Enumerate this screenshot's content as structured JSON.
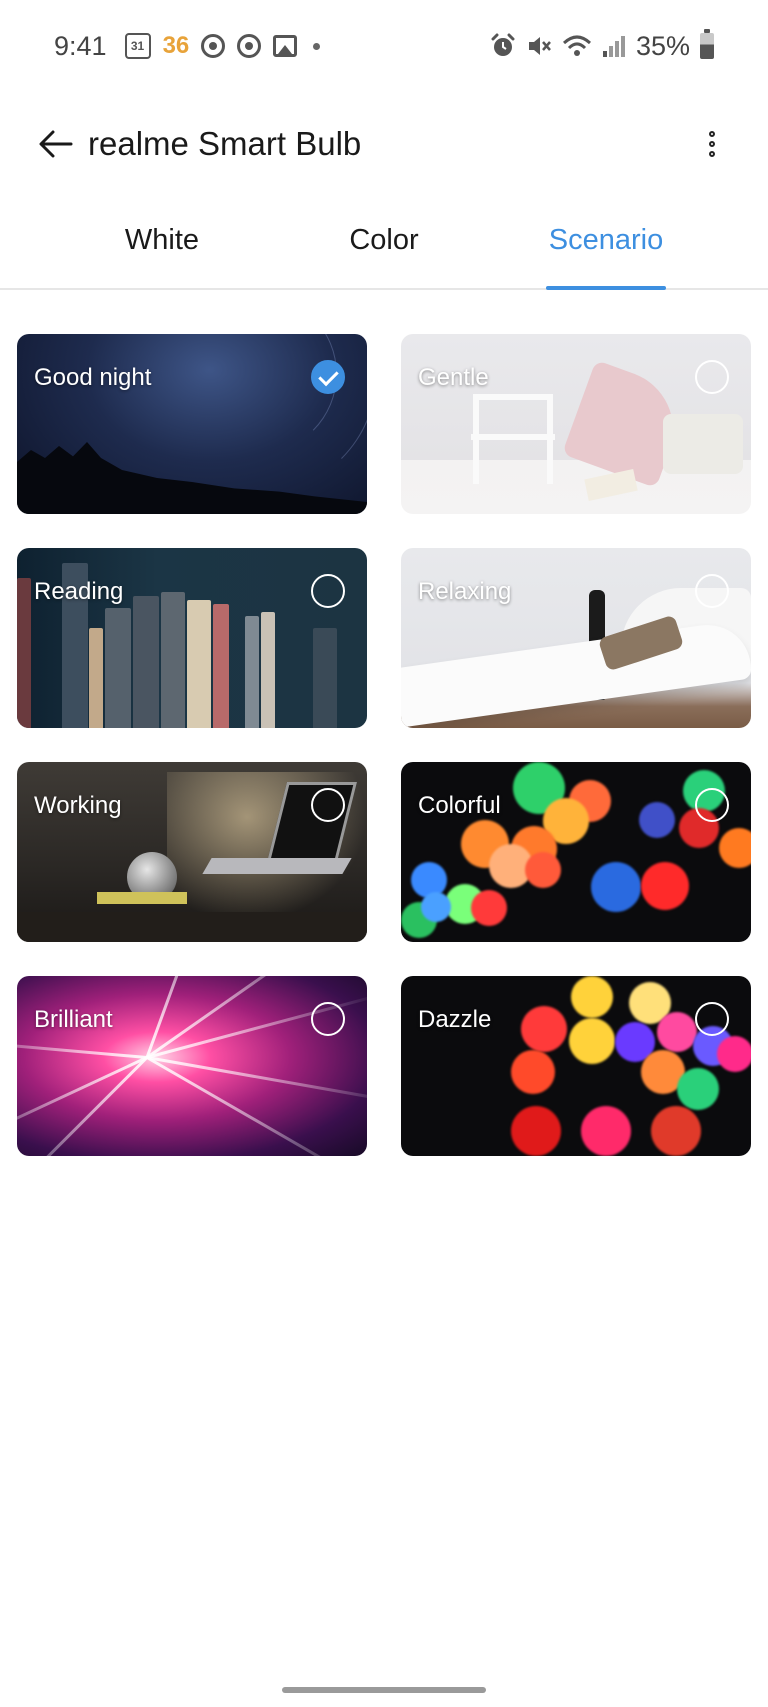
{
  "status_bar": {
    "time": "9:41",
    "calendar_day": "31",
    "temperature": "36",
    "battery_text": "35%",
    "battery_level": 0.35,
    "icons": [
      "calendar-icon",
      "sync-icon",
      "sync-icon",
      "image-icon",
      "dot-icon",
      "alarm-icon",
      "mute-icon",
      "wifi-icon",
      "signal-icon",
      "battery-icon"
    ]
  },
  "header": {
    "title": "realme Smart Bulb",
    "back_icon": "arrow-left-icon",
    "menu_icon": "more-vertical-icon"
  },
  "tabs": [
    {
      "label": "White",
      "active": false
    },
    {
      "label": "Color",
      "active": false
    },
    {
      "label": "Scenario",
      "active": true
    }
  ],
  "accent_color": "#3d8fe0",
  "scenarios": [
    {
      "label": "Good night",
      "selected": true
    },
    {
      "label": "Gentle",
      "selected": false
    },
    {
      "label": "Reading",
      "selected": false
    },
    {
      "label": "Relaxing",
      "selected": false
    },
    {
      "label": "Working",
      "selected": false
    },
    {
      "label": "Colorful",
      "selected": false
    },
    {
      "label": "Brilliant",
      "selected": false
    },
    {
      "label": "Dazzle",
      "selected": false
    }
  ]
}
